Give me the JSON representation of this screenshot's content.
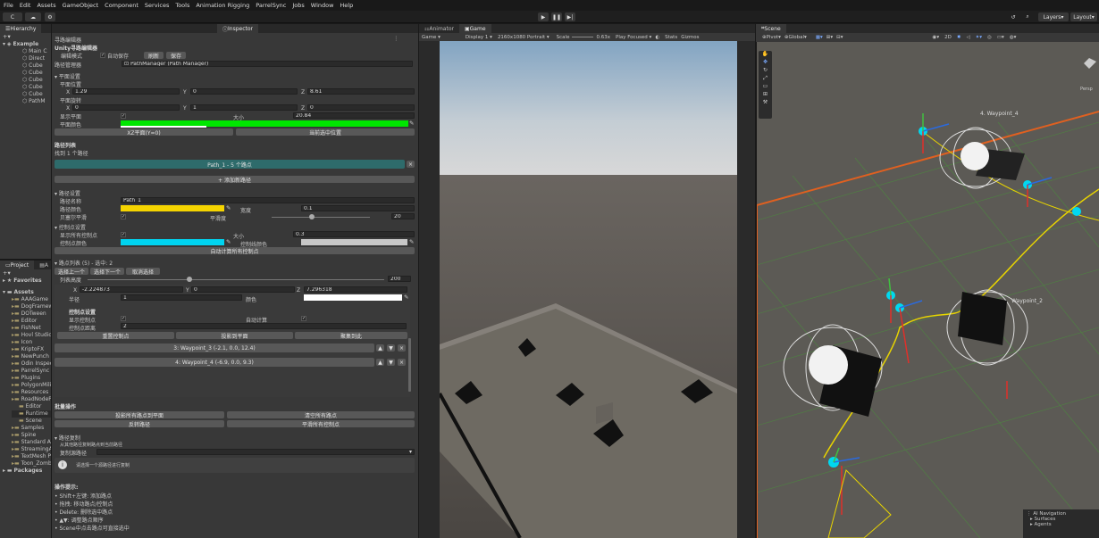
{
  "menu": [
    "File",
    "Edit",
    "Assets",
    "GameObject",
    "Component",
    "Services",
    "Tools",
    "Animation Rigging",
    "ParrelSync",
    "Jobs",
    "Window",
    "Help"
  ],
  "toolbar": {
    "account": "C",
    "layers": "Layers",
    "layout": "Layout"
  },
  "hierarchy": {
    "tab": "Hierarchy",
    "scene": "Example",
    "items": [
      "Main C",
      "Direct",
      "Cube",
      "Cube",
      "Cube",
      "Cube",
      "Cube",
      "PathM"
    ]
  },
  "project": {
    "tab": "Project",
    "tab2": "A",
    "favorites": "Favorites",
    "assets": "Assets",
    "items": [
      "AAAGame",
      "DogFramew",
      "DOTween",
      "Editor",
      "FishNet",
      "Hovl Studio",
      "Icon",
      "KriptoFX",
      "NewPunch",
      "Odin Inspect",
      "ParrelSync",
      "Plugins",
      "PolygonMilit",
      "Resources",
      "RoadNodeP",
      "Editor",
      "Runtime",
      "Scene",
      "Samples",
      "Spine",
      "Standard As",
      "StreamingA",
      "TextMesh P",
      "Toon_Zomb"
    ],
    "packages": "Packages"
  },
  "inspector": {
    "tab": "Inspector",
    "editor_title": "寻路编辑器",
    "unity_title": "Unity寻路编辑器",
    "edit_mode": "编辑模式",
    "auto_save": "自动保存",
    "refresh": "刷新",
    "save": "保存",
    "path_manager_label": "路径管理器",
    "path_manager_value": "PathManager (Path Manager)",
    "plane_settings": "平面设置",
    "plane_pos": "平面位置",
    "pos": {
      "x": "1.29",
      "y": "0",
      "z": "8.61"
    },
    "plane_rot": "平面旋转",
    "rot": {
      "x": "0",
      "y": "1",
      "z": "0"
    },
    "show_plane": "显示平面",
    "size_label": "大小",
    "size_value": "20.84",
    "plane_color": "平面颜色",
    "xz_plane": "XZ平面(Y=0)",
    "current_pos": "当前选中位置",
    "path_list": "路径列表",
    "found": "找到 1 个路径",
    "path_item": "Path_1 - 5 个路点",
    "add_path": "+ 添加新路径",
    "path_settings": "路径设置",
    "path_name_label": "路径名称",
    "path_name": "Path_1",
    "path_color": "路径颜色",
    "width_label": "宽度",
    "width": "0.1",
    "bezier": "贝塞尔平滑",
    "smooth_label": "平滑度",
    "smooth": "20",
    "cp_settings": "控制点设置",
    "show_cp": "显示所有控制点",
    "cp_size_label": "大小",
    "cp_size": "0.3",
    "cp_color": "控制点颜色",
    "cp_line_color": "控制线颜色",
    "auto_calc": "自动计算所有控制点",
    "wp_list": "路点列表 (5) - 选中: 2",
    "sel_prev": "选择上一个",
    "sel_next": "选择下一个",
    "cancel_sel": "取消选择",
    "list_height": "列表高度",
    "list_height_val": "200",
    "wp_pos": {
      "x": "-2.224873",
      "y": "0",
      "z": "7.296318"
    },
    "radius_label": "半径",
    "radius": "1",
    "color_label": "颜色",
    "cp_set2": "控制点设置",
    "show_cp2": "显示控制点",
    "auto_calc2": "自动计算",
    "cp_dist": "控制点距离",
    "cp_dist_val": "2",
    "reset_cp": "重置控制点",
    "proj_cp": "投影到平面",
    "gather": "聚集到此",
    "wp3": "3: Waypoint_3 (-2.1, 0.0, 12.4)",
    "wp4": "4: Waypoint_4 (-6.9, 0.0, 9.3)",
    "batch": "批量操作",
    "proj_all": "投影所有路点到平面",
    "clear_all": "清空所有路点",
    "reverse": "反转路径",
    "smooth_all": "平滑所有控制点",
    "path_copy": "路径复制",
    "copy_hint": "从其他路径复制路点到当前路径",
    "copy_path": "复制源路径",
    "copy_warn": "请选择一个源路径进行复制",
    "tips_title": "操作提示:",
    "tips": [
      "• Shift+左键: 添加路点",
      "• 拖拽: 移动路点/控制点",
      "• Delete: 删除选中路点",
      "• ▲▼: 调整路点顺序",
      "• Scene中点击路点可直接选中"
    ]
  },
  "game": {
    "tab1": "Animator",
    "tab2": "Game",
    "mode": "Game",
    "display": "Display 1",
    "res": "2160x1080 Portrait",
    "scale_label": "Scale",
    "scale": "0.63x",
    "play_focused": "Play Focused",
    "stats": "Stats",
    "gizmos": "Gizmos"
  },
  "scene": {
    "tab": "Scene",
    "pivot": "Pivot",
    "global": "Global",
    "mode2d": "2D",
    "wp4": "4. Waypoint_4",
    "wp2": "Waypoint_2",
    "persp": "Persp",
    "nav_title": "AI Navigation",
    "nav_items": [
      "Surfaces",
      "Agents"
    ]
  },
  "colors": {
    "plane": "#00e600",
    "path": "#f5d400",
    "cp": "#00d4f0",
    "cpline": "#c8c8c8",
    "wp": "#ffffff",
    "selected_path": "#2e6b6b"
  }
}
